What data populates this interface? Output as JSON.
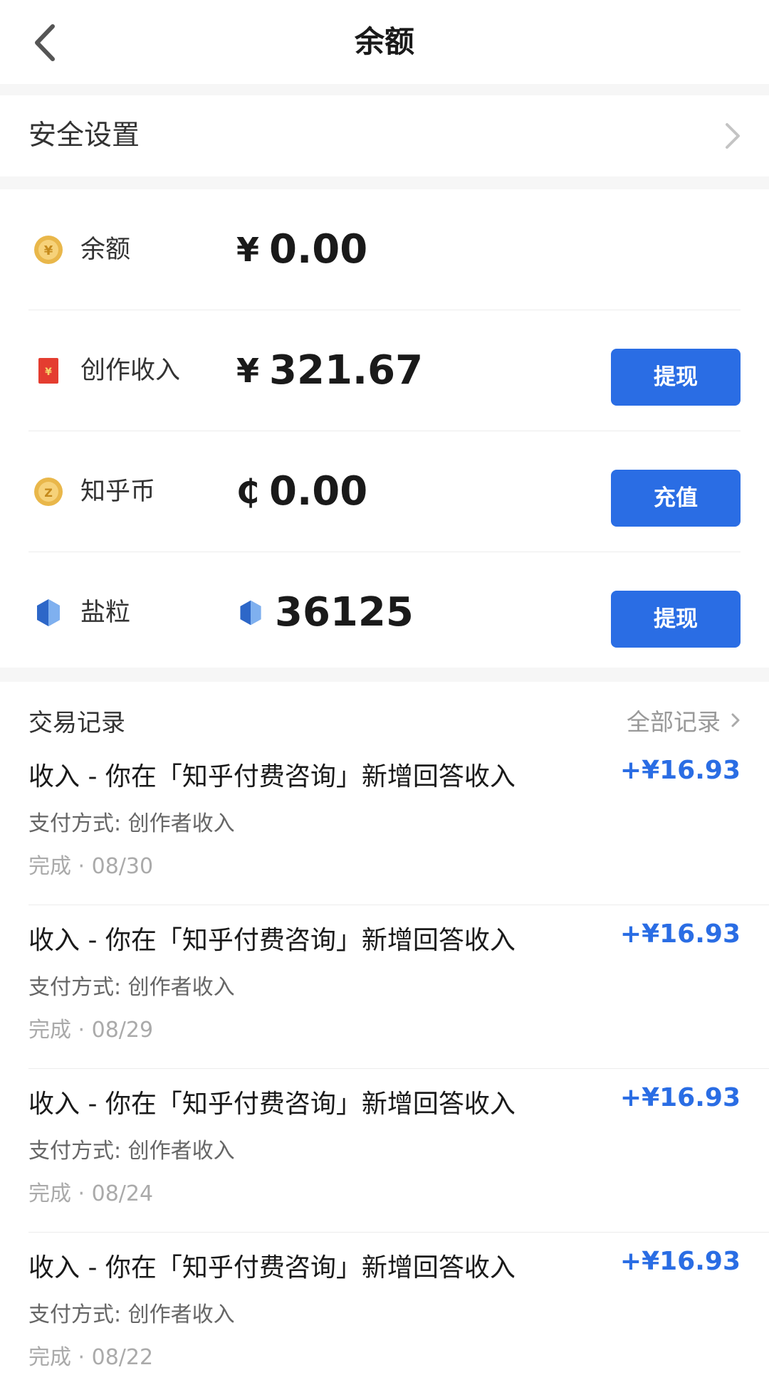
{
  "header": {
    "title": "余额",
    "back_icon": "chevron-left-icon"
  },
  "security": {
    "label": "安全设置",
    "chevron_icon": "chevron-right-icon"
  },
  "accounts": [
    {
      "label": "余额",
      "currency": "¥",
      "amount": "0.00",
      "icon": "yuan-coin-icon",
      "button": ""
    },
    {
      "label": "创作收入",
      "currency": "¥",
      "amount": "321.67",
      "icon": "red-envelope-icon",
      "button": "提现"
    },
    {
      "label": "知乎币",
      "currency": "₵",
      "amount": "0.00",
      "icon": "zhihu-coin-icon",
      "button": "充值"
    },
    {
      "label": "盐粒",
      "currency": "",
      "amount": "36125",
      "icon": "salt-crystal-icon",
      "button": "提现"
    }
  ],
  "records": {
    "title": "交易记录",
    "all_label": "全部记录",
    "items": [
      {
        "title": "收入 - 你在「知乎付费咨询」新增回答收入",
        "amount": "+¥16.93",
        "method": "支付方式: 创作者收入",
        "status": "完成 · 08/30"
      },
      {
        "title": "收入 - 你在「知乎付费咨询」新增回答收入",
        "amount": "+¥16.93",
        "method": "支付方式: 创作者收入",
        "status": "完成 · 08/29"
      },
      {
        "title": "收入 - 你在「知乎付费咨询」新增回答收入",
        "amount": "+¥16.93",
        "method": "支付方式: 创作者收入",
        "status": "完成 · 08/24"
      },
      {
        "title": "收入 - 你在「知乎付费咨询」新增回答收入",
        "amount": "+¥16.93",
        "method": "支付方式: 创作者收入",
        "status": "完成 · 08/22"
      }
    ]
  },
  "colors": {
    "accent": "#2a6de4",
    "background": "#f6f6f6",
    "card": "#ffffff"
  }
}
